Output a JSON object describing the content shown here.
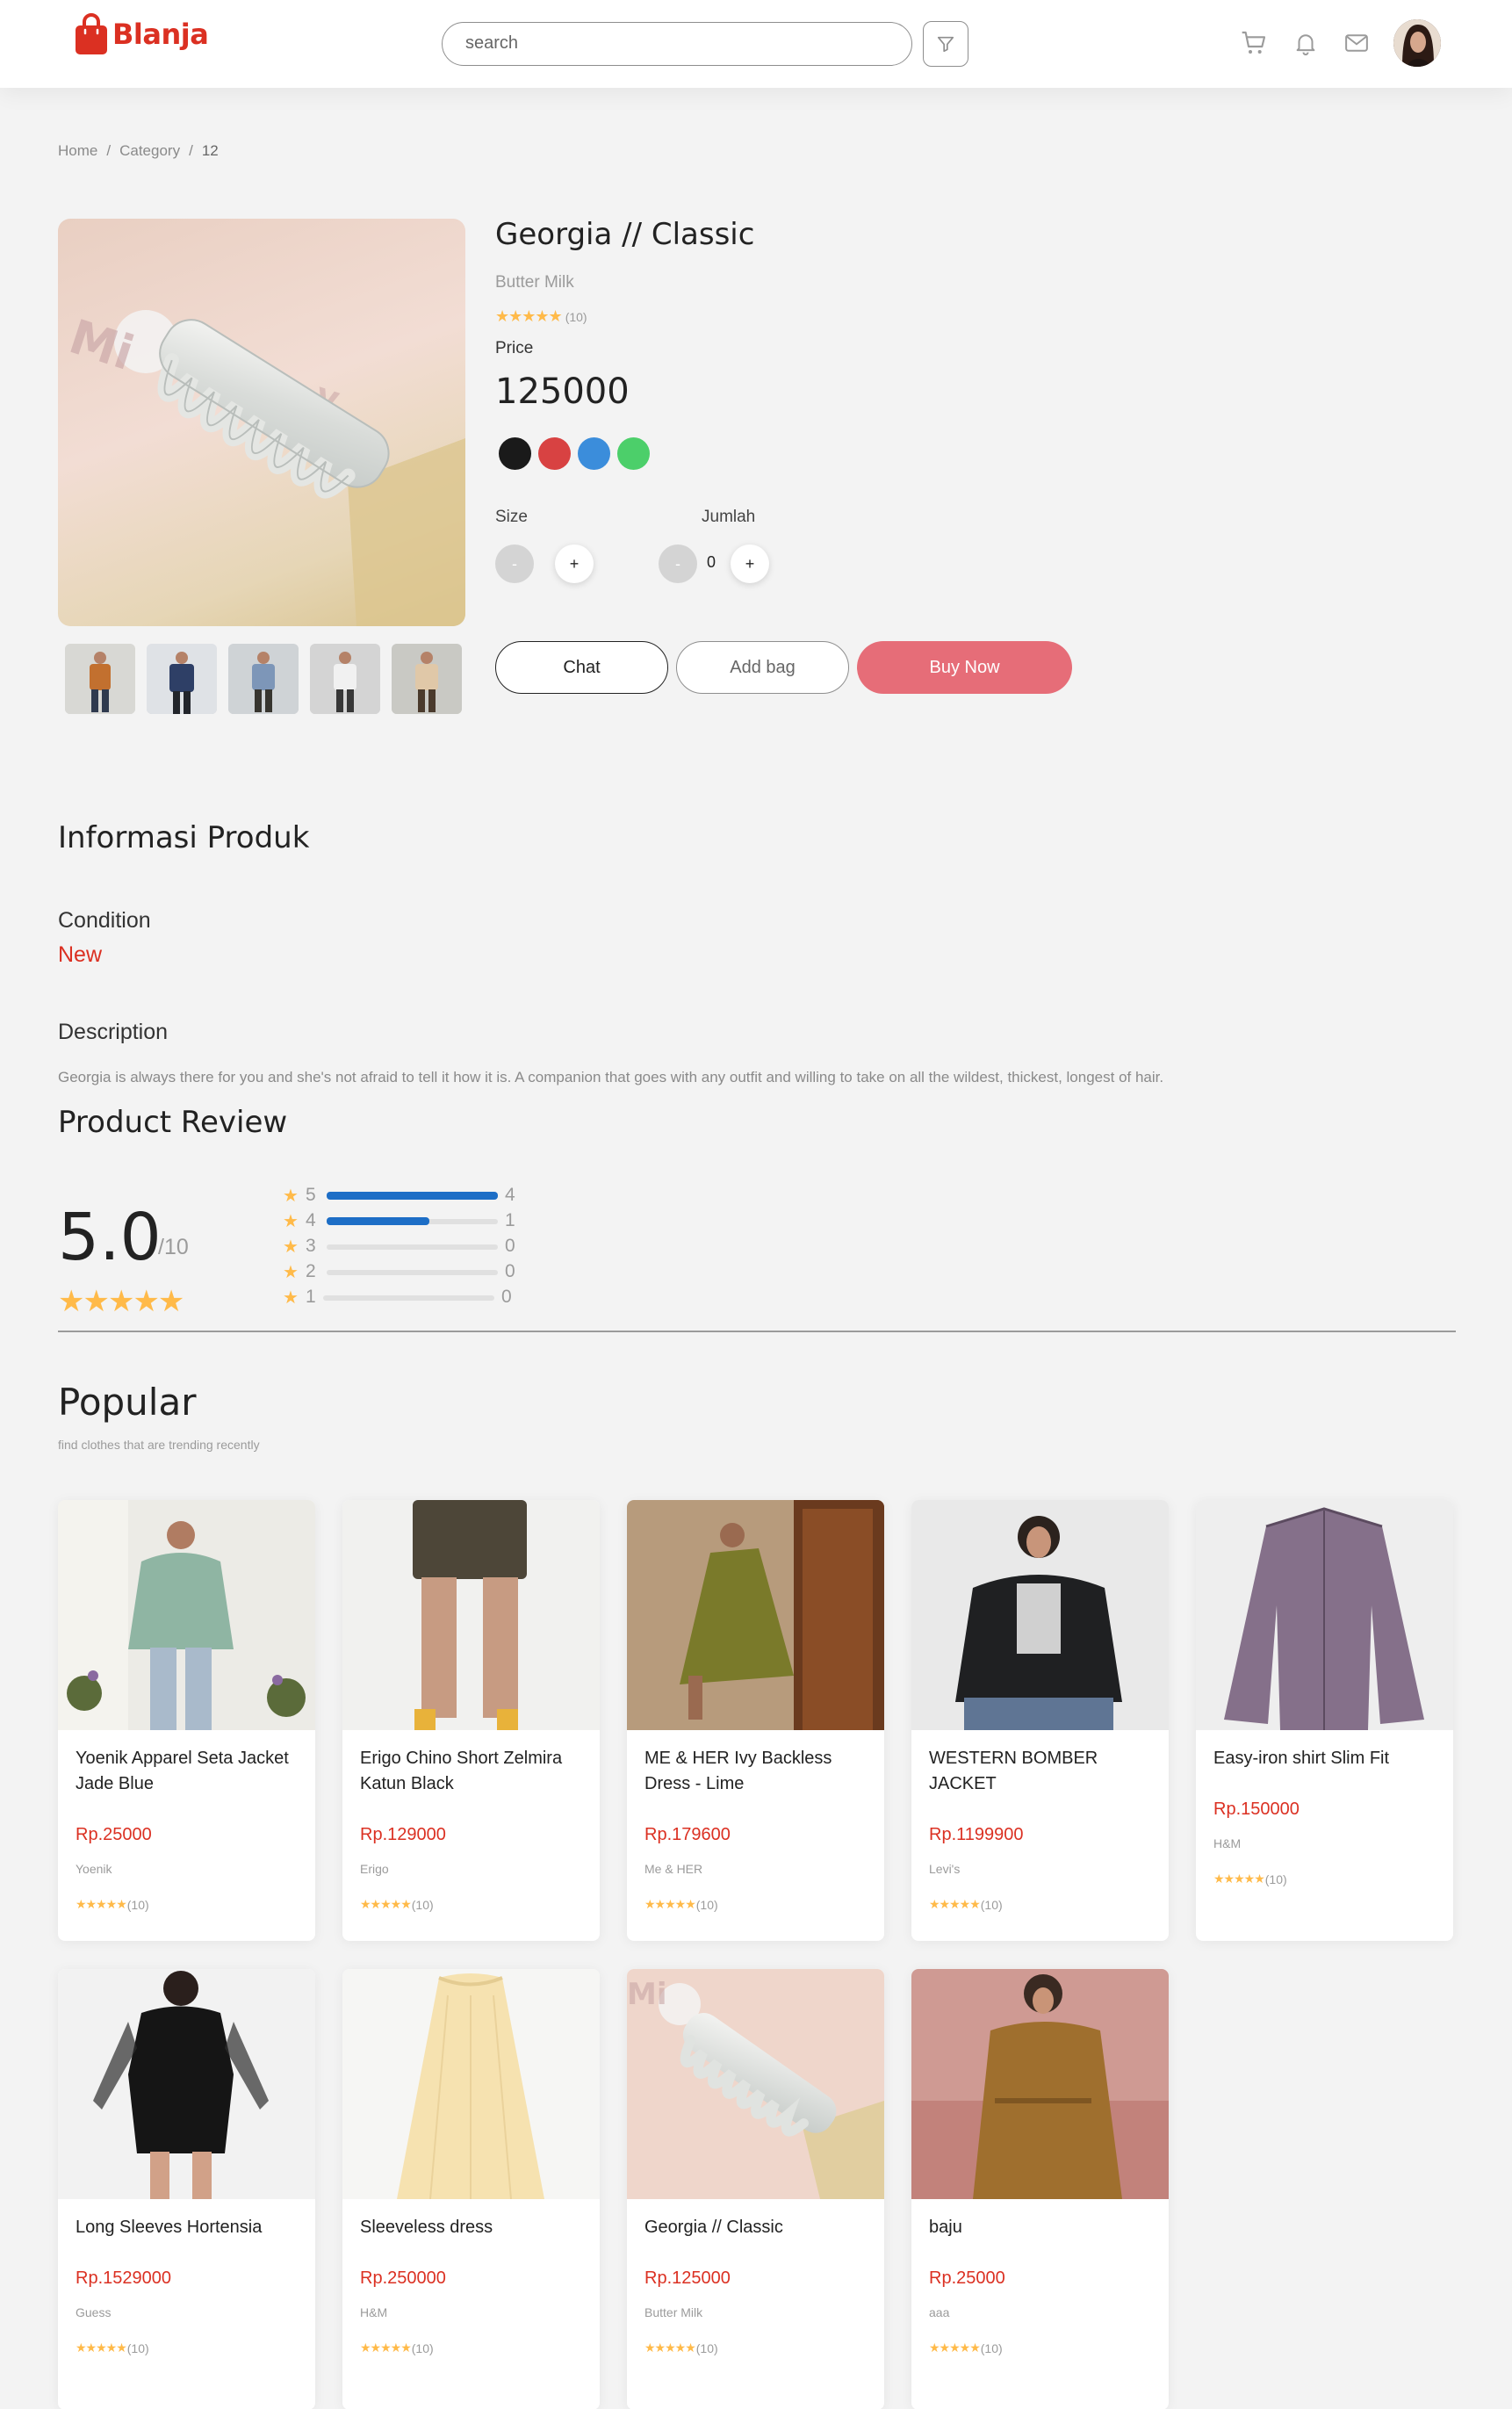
{
  "brand": {
    "name": "Blanja"
  },
  "search": {
    "placeholder": "search"
  },
  "breadcrumb": [
    "Home",
    "Category",
    "12"
  ],
  "product": {
    "title": "Georgia // Classic",
    "brand": "Butter Milk",
    "rating_count": "(10)",
    "price_label": "Price",
    "price": "125000",
    "colors": [
      "#1a1a1a",
      "#d84242",
      "#3b8ddb",
      "#4ccf6a"
    ],
    "size_label": "Size",
    "qty_label": "Jumlah",
    "minus": "-",
    "plus": "+",
    "qty_value": "0",
    "chat_label": "Chat",
    "bag_label": "Add bag",
    "buy_label": "Buy Now"
  },
  "info": {
    "title": "Informasi Produk",
    "condition_label": "Condition",
    "condition_value": "New",
    "description_label": "Description",
    "description": "Georgia is always there for you and she's not afraid to tell it how it is. A companion that goes with any outfit and willing to take on all the wildest, thickest, longest of hair."
  },
  "review": {
    "title": "Product Review",
    "score": "5.0",
    "score_of": "/10",
    "breakdown": [
      {
        "stars": "5",
        "count": "4",
        "fraction": 1.0
      },
      {
        "stars": "4",
        "count": "1",
        "fraction": 0.6
      },
      {
        "stars": "3",
        "count": "0",
        "fraction": 0
      },
      {
        "stars": "2",
        "count": "0",
        "fraction": 0
      },
      {
        "stars": "1",
        "count": "0",
        "fraction": 0
      }
    ]
  },
  "popular": {
    "title": "Popular",
    "subtitle": "find clothes that are trending recently",
    "products": [
      {
        "name": "Yoenik Apparel Seta Jacket Jade Blue",
        "price": "Rp.25000",
        "brand": "Yoenik",
        "rating_count": "(10)"
      },
      {
        "name": "Erigo Chino Short Zelmira Katun Black",
        "price": "Rp.129000",
        "brand": "Erigo",
        "rating_count": "(10)"
      },
      {
        "name": "ME & HER Ivy Backless Dress - Lime",
        "price": "Rp.179600",
        "brand": "Me & HER",
        "rating_count": "(10)"
      },
      {
        "name": "WESTERN BOMBER JACKET",
        "price": "Rp.1199900",
        "brand": "Levi's",
        "rating_count": "(10)"
      },
      {
        "name": "Easy-iron shirt Slim Fit",
        "price": "Rp.150000",
        "brand": "H&M",
        "rating_count": "(10)"
      },
      {
        "name": "Long Sleeves Hortensia",
        "price": "Rp.1529000",
        "brand": "Guess",
        "rating_count": "(10)"
      },
      {
        "name": "Sleeveless dress",
        "price": "Rp.250000",
        "brand": "H&M",
        "rating_count": "(10)"
      },
      {
        "name": "Georgia // Classic",
        "price": "Rp.125000",
        "brand": "Butter Milk",
        "rating_count": "(10)"
      },
      {
        "name": "baju",
        "price": "Rp.25000",
        "brand": "aaa",
        "rating_count": "(10)"
      }
    ]
  }
}
